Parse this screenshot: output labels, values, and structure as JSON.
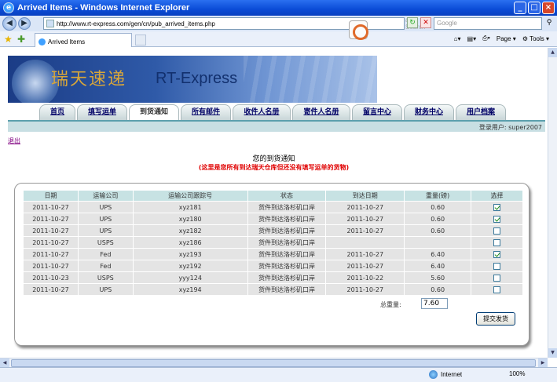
{
  "window": {
    "title": "Arrived Items - Windows Internet Explorer"
  },
  "address": {
    "url": "http://www.rt-express.com/gen/cn/pub_arrived_items.php",
    "ghost": "art Search",
    "search_placeholder": "Google"
  },
  "tab": {
    "label": "Arrived Items"
  },
  "toolbar": {
    "page_label": "Page",
    "tools_label": "Tools"
  },
  "statusbar": {
    "zone": "Internet",
    "zoom": "100%"
  },
  "banner": {
    "cn": "瑞天速递",
    "en": "RT-Express"
  },
  "nav": {
    "items": [
      "首页",
      "填写运单",
      "到货通知",
      "所有邮件",
      "收件人名册",
      "寄件人名册",
      "留言中心",
      "财务中心",
      "用户档案"
    ],
    "login": "登录用户: super2007"
  },
  "logout": "退出",
  "heading": {
    "title": "您的到货通知",
    "subtitle": "(这里是您所有到达瑞天仓库但还没有填写运单的货物)"
  },
  "table": {
    "headers": [
      "日期",
      "运输公司",
      "运输公司跟踪号",
      "状态",
      "到达日期",
      "重量(磅)",
      "选择"
    ],
    "rows": [
      {
        "date": "2011-10-27",
        "carrier": "UPS",
        "track": "xyz181",
        "status": "货件到达洛杉矶口岸",
        "arrive": "2011-10-27",
        "weight": "0.60",
        "checked": true
      },
      {
        "date": "2011-10-27",
        "carrier": "UPS",
        "track": "xyz180",
        "status": "货件到达洛杉矶口岸",
        "arrive": "2011-10-27",
        "weight": "0.60",
        "checked": true
      },
      {
        "date": "2011-10-27",
        "carrier": "UPS",
        "track": "xyz182",
        "status": "货件到达洛杉矶口岸",
        "arrive": "2011-10-27",
        "weight": "0.60",
        "checked": false
      },
      {
        "date": "2011-10-27",
        "carrier": "USPS",
        "track": "xyz186",
        "status": "货件到达洛杉矶口岸",
        "arrive": "",
        "weight": "",
        "checked": false
      },
      {
        "date": "2011-10-27",
        "carrier": "Fed",
        "track": "xyz193",
        "status": "货件到达洛杉矶口岸",
        "arrive": "2011-10-27",
        "weight": "6.40",
        "checked": true
      },
      {
        "date": "2011-10-27",
        "carrier": "Fed",
        "track": "xyz192",
        "status": "货件到达洛杉矶口岸",
        "arrive": "2011-10-27",
        "weight": "6.40",
        "checked": false
      },
      {
        "date": "2011-10-23",
        "carrier": "USPS",
        "track": "yyy124",
        "status": "货件到达洛杉矶口岸",
        "arrive": "2011-10-22",
        "weight": "5.60",
        "checked": false
      },
      {
        "date": "2011-10-27",
        "carrier": "UPS",
        "track": "xyz194",
        "status": "货件到达洛杉矶口岸",
        "arrive": "2011-10-27",
        "weight": "0.60",
        "checked": false
      }
    ],
    "total_label": "总重量:",
    "total_value": "7.60",
    "submit_label": "提交发货"
  }
}
